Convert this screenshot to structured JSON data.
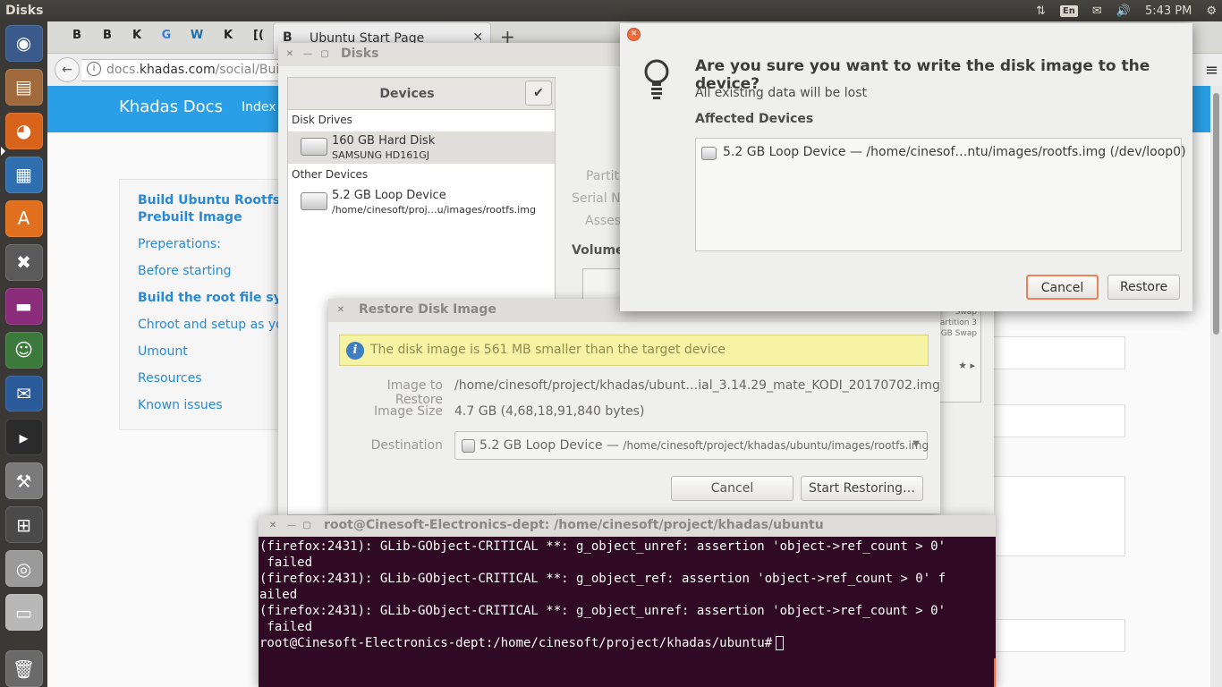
{
  "top_panel": {
    "app_name": "Disks",
    "lang": "En",
    "time": "5:43 PM"
  },
  "launcher": {
    "items": [
      "dash-icon",
      "files-icon",
      "firefox-icon",
      "writer-icon",
      "software-center-icon",
      "system-settings-icon",
      "impress-icon",
      "contacts-icon",
      "thunderbird-icon",
      "terminal-icon",
      "disk-utility-icon",
      "workspace-switcher-icon",
      "drive-icon",
      "removable-drive-icon",
      "trash-icon"
    ]
  },
  "firefox": {
    "active_tab_title": "Ubuntu Start Page",
    "tab_icons": [
      "B",
      "B",
      "K",
      "G",
      "W",
      "K",
      "[(",
      "B"
    ],
    "url_prefix": "docs.",
    "url_domain": "khadas.com",
    "url_rest": "/social/Bui",
    "site_logo": "Khadas Docs",
    "site_nav_index": "Index",
    "toc": [
      {
        "label": "Build Ubuntu Rootfs vi",
        "bold": true
      },
      {
        "label": "Prebuilt Image",
        "bold": true
      },
      {
        "label": "Preperations:",
        "bold": false
      },
      {
        "label": "Before starting",
        "bold": false
      },
      {
        "label": "Build the root file syste",
        "bold": true
      },
      {
        "label": "Chroot and setup as you",
        "bold": false
      },
      {
        "label": "Umount",
        "bold": false
      },
      {
        "label": "Resources",
        "bold": false
      },
      {
        "label": "Known issues",
        "bold": false
      }
    ]
  },
  "disks": {
    "title": "Disks",
    "devices_header": "Devices",
    "section_drives": "Disk Drives",
    "section_other": "Other Devices",
    "devices": [
      {
        "name": "160 GB Hard Disk",
        "sub": "SAMSUNG HD161GJ"
      },
      {
        "name": "5.2 GB Loop Device",
        "sub": "/home/cinesoft/proj…u/images/rootfs.img"
      }
    ],
    "bg_labels": [
      "Partiti",
      "Serial Nu",
      "Assess",
      "Volume"
    ],
    "bg_swap": [
      "Swap",
      "artition 3",
      "GB Swap"
    ]
  },
  "restore": {
    "title": "Restore Disk Image",
    "info": "The disk image is 561 MB smaller than the target device",
    "image_label": "Image to Restore",
    "image_value": "/home/cinesoft/project/khadas/ubunt…ial_3.14.29_mate_KODI_20170702.img",
    "size_label": "Image Size",
    "size_value": "4.7 GB (4,68,18,91,840 bytes)",
    "dest_label": "Destination",
    "dest_name": "5.2 GB Loop Device —",
    "dest_path": "/home/cinesoft/project/khadas/ubuntu/images/rootfs.img",
    "cancel": "Cancel",
    "start": "Start Restoring…"
  },
  "terminal": {
    "title": "root@Cinesoft-Electronics-dept: /home/cinesoft/project/khadas/ubuntu",
    "lines": [
      "(firefox:2431): GLib-GObject-CRITICAL **: g_object_unref: assertion 'object->ref_count > 0'",
      " failed",
      "",
      "(firefox:2431): GLib-GObject-CRITICAL **: g_object_ref: assertion 'object->ref_count > 0' f",
      "ailed",
      "",
      "(firefox:2431): GLib-GObject-CRITICAL **: g_object_unref: assertion 'object->ref_count > 0'",
      " failed"
    ],
    "prompt": "root@Cinesoft-Electronics-dept:/home/cinesoft/project/khadas/ubuntu#"
  },
  "confirm": {
    "heading": "Are you sure you want to write the disk image to the device?",
    "subtext": "All existing data will be lost",
    "affected_label": "Affected Devices",
    "affected_item": "5.2 GB Loop Device — /home/cinesof…ntu/images/rootfs.img (/dev/loop0)",
    "cancel": "Cancel",
    "restore": "Restore"
  },
  "colors": {
    "accent_orange": "#f06c3a",
    "site_blue": "#2a9ee6",
    "terminal_bg": "#300a24",
    "info_yellow": "#f6f3a4"
  }
}
